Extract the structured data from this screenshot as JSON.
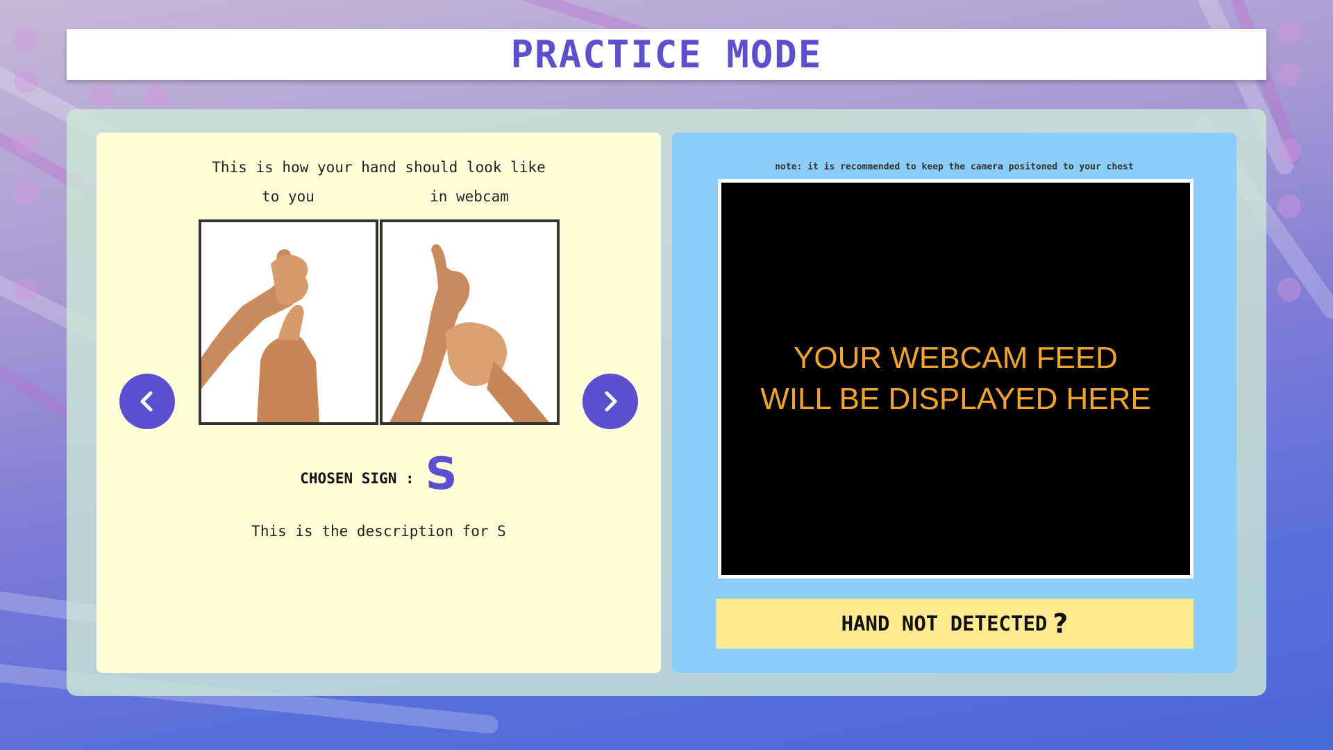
{
  "header": {
    "title": "PRACTICE MODE"
  },
  "left_panel": {
    "instruction": "This is how your hand should look like",
    "label_you": "to you",
    "label_webcam": "in webcam",
    "prev_icon": "chevron-left-icon",
    "next_icon": "chevron-right-icon",
    "chosen_label": "CHOSEN SIGN :",
    "chosen_letter": "S",
    "description": "This is the description for S"
  },
  "right_panel": {
    "note": "note: it is recommended to keep the camera positoned to your chest",
    "webcam_line1": "YOUR WEBCAM FEED",
    "webcam_line2": "WILL BE DISPLAYED HERE",
    "status": "HAND NOT DETECTED",
    "status_icon": "?"
  },
  "colors": {
    "accent": "#5b4fd0",
    "webcam_text": "#f5a42a",
    "left_card_bg": "#fffed9",
    "right_card_bg": "#89cdf8",
    "status_bg": "#ffeb8f"
  }
}
